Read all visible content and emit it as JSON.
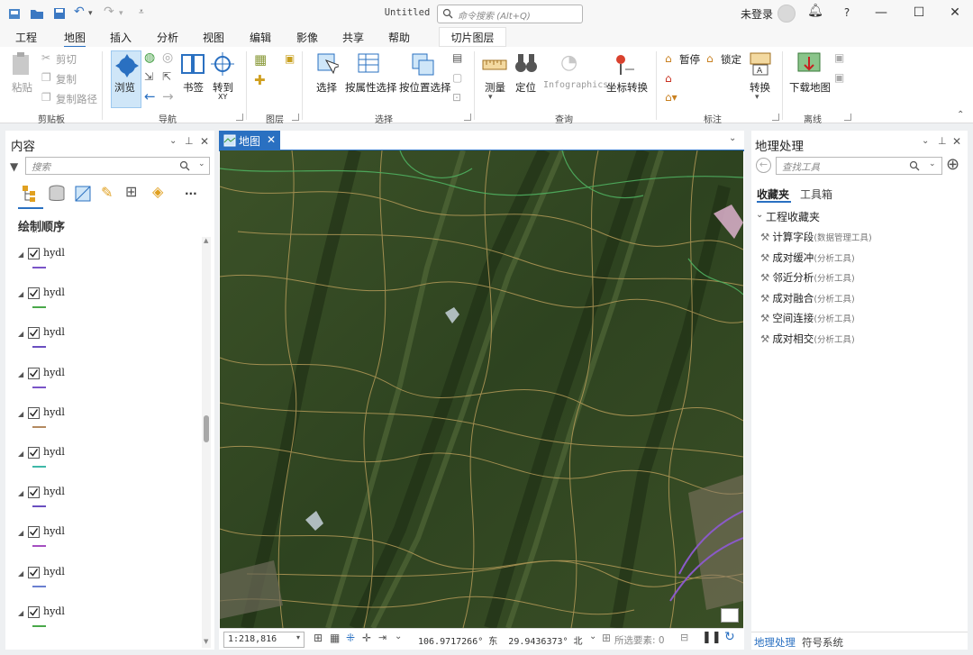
{
  "window": {
    "title": "Untitled",
    "command_search_placeholder": "命令搜索 (Alt+Q)",
    "login": "未登录",
    "help": "?"
  },
  "tabs": [
    "工程",
    "地图",
    "插入",
    "分析",
    "视图",
    "编辑",
    "影像",
    "共享",
    "帮助"
  ],
  "contextual_tab": "切片图层",
  "ribbon": {
    "clipboard": {
      "paste": "粘贴",
      "cut": "剪切",
      "copy": "复制",
      "copy_path": "复制路径",
      "group": "剪贴板"
    },
    "navigate": {
      "explore": "浏览",
      "bookmarks": "书签",
      "goto": "转到",
      "goto_sub": "XY",
      "group": "导航"
    },
    "layer": {
      "group": "图层"
    },
    "selection": {
      "select": "选择",
      "by_attr": "按属性选择",
      "by_loc": "按位置选择",
      "group": "选择"
    },
    "inquiry": {
      "measure": "测量",
      "locate": "定位",
      "infographics": "Infographics",
      "coord_convert": "坐标转换",
      "group": "查询"
    },
    "labeling": {
      "pause": "暂停",
      "lock": "锁定",
      "convert": "转换",
      "group": "标注"
    },
    "offline": {
      "download": "下载地图",
      "group": "离线"
    }
  },
  "contents": {
    "title": "内容",
    "search_placeholder": "搜索",
    "drawing_order": "绘制顺序",
    "more": "...",
    "layers": [
      {
        "name": "hydl",
        "checked": true,
        "color": "#7a55c8"
      },
      {
        "name": "hydl",
        "checked": true,
        "color": "#4aa84a"
      },
      {
        "name": "hydl",
        "checked": true,
        "color": "#6a4fc0"
      },
      {
        "name": "hydl",
        "checked": true,
        "color": "#7a55c8"
      },
      {
        "name": "hydl",
        "checked": true,
        "color": "#b48a60"
      },
      {
        "name": "hydl",
        "checked": true,
        "color": "#3fb8a8"
      },
      {
        "name": "hydl",
        "checked": true,
        "color": "#6a4fc0"
      },
      {
        "name": "hydl",
        "checked": true,
        "color": "#a54fc0"
      },
      {
        "name": "hydl",
        "checked": true,
        "color": "#6a7fd0"
      },
      {
        "name": "hydl",
        "checked": true,
        "color": "#4aa84a"
      }
    ]
  },
  "map": {
    "tab_label": "地图",
    "scale": "1:218,816",
    "coordinates": "106.9717266° 东  29.9436373° 北",
    "selected_features": "所选要素: 0"
  },
  "geoprocessing": {
    "title": "地理处理",
    "search_placeholder": "查找工具",
    "tab_favorites": "收藏夹",
    "tab_toolboxes": "工具箱",
    "section": "工程收藏夹",
    "tools": [
      {
        "name": "计算字段",
        "category": "(数据管理工具)"
      },
      {
        "name": "成对缓冲",
        "category": "(分析工具)"
      },
      {
        "name": "邻近分析",
        "category": "(分析工具)"
      },
      {
        "name": "成对融合",
        "category": "(分析工具)"
      },
      {
        "name": "空间连接",
        "category": "(分析工具)"
      },
      {
        "name": "成对相交",
        "category": "(分析工具)"
      }
    ]
  },
  "bottom_tabs": {
    "geoprocessing": "地理处理",
    "symbology": "符号系统"
  }
}
